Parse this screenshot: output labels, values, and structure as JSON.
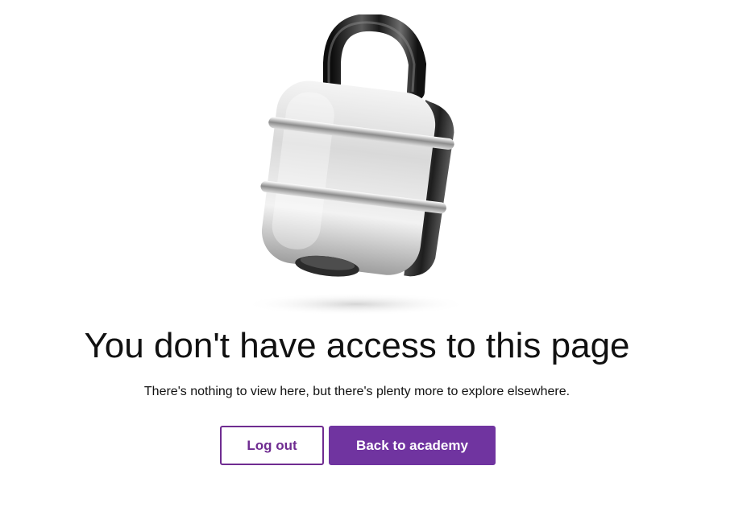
{
  "illustration": {
    "icon": "padlock-icon"
  },
  "main": {
    "title": "You don't have access to this page",
    "subtitle": "There's nothing to view here, but there's plenty more to explore elsewhere."
  },
  "actions": {
    "logout_label": "Log out",
    "back_label": "Back to academy"
  },
  "colors": {
    "accent": "#7034a0",
    "text": "#111111",
    "background": "#ffffff"
  }
}
